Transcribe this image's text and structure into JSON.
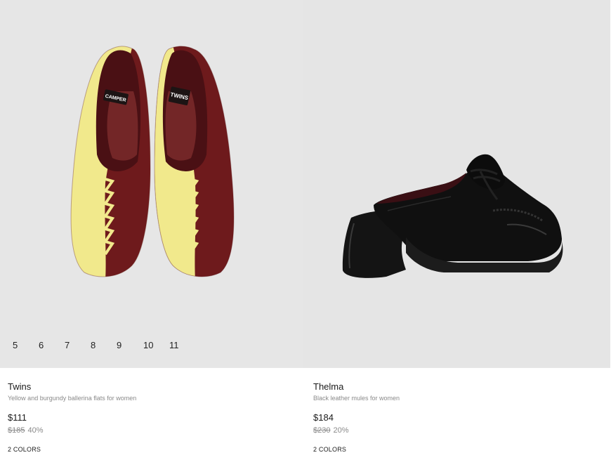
{
  "products": [
    {
      "name": "Twins",
      "description": "Yellow and burgundy ballerina flats for women",
      "price": "$111",
      "original_price": "$185",
      "discount": "40%",
      "colors": "2 COLORS",
      "image_icon": "shoe-image",
      "image_colors": [
        "#f1e98c",
        "#6e1a1c"
      ],
      "insole_labels": [
        "CAMPER",
        "TWINS"
      ],
      "sizes": [
        "5",
        "6",
        "7",
        "8",
        "9",
        "10",
        "11"
      ]
    },
    {
      "name": "Thelma",
      "description": "Black leather mules for women",
      "price": "$184",
      "original_price": "$230",
      "discount": "20%",
      "colors": "2 COLORS",
      "image_icon": "shoe-image",
      "image_colors": [
        "#111111",
        "#3a0f14"
      ]
    }
  ]
}
